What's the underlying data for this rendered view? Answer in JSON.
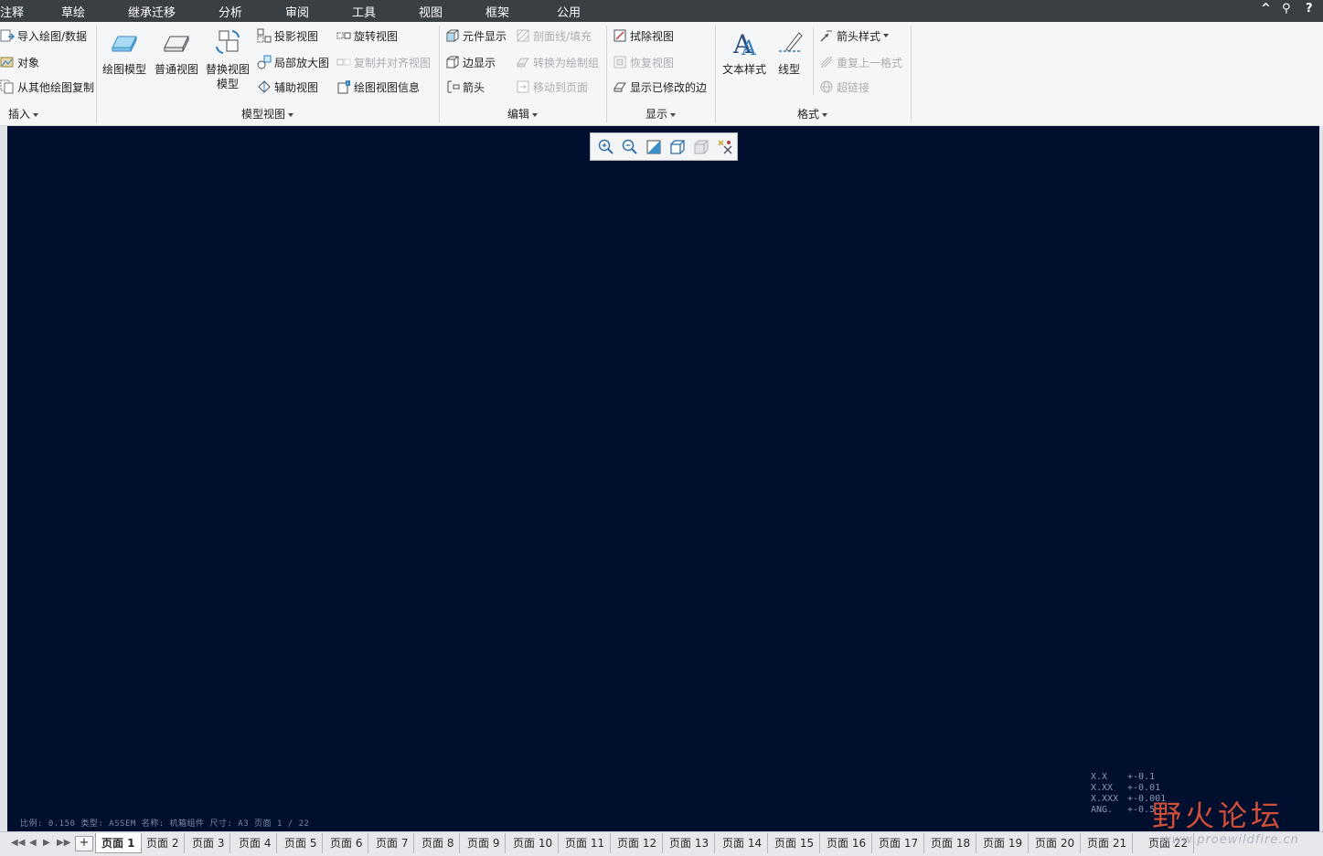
{
  "menubar": {
    "tabs": [
      "注释",
      "草绘",
      "继承迁移",
      "分析",
      "审阅",
      "工具",
      "视图",
      "框架",
      "公用"
    ],
    "right": {
      "collapse": "^",
      "search": "⚲",
      "help": "?"
    }
  },
  "ribbon": {
    "insert": {
      "label": "插入",
      "items": [
        "导入绘图/数据",
        "对象",
        "从其他绘图复制"
      ]
    },
    "model_views": {
      "label": "模型视图",
      "large": [
        "绘图模型",
        "普通视图",
        "替换视图",
        "模型"
      ],
      "col1": [
        "投影视图",
        "局部放大图",
        "辅助视图"
      ],
      "col2": [
        "旋转视图",
        "复制并对齐视图",
        "绘图视图信息"
      ]
    },
    "edit": {
      "label": "编辑",
      "col1": [
        "元件显示",
        "边显示",
        "箭头"
      ],
      "col2": [
        "剖面线/填充",
        "转换为绘制组",
        "移动到页面"
      ]
    },
    "display": {
      "label": "显示",
      "items": [
        "拭除视图",
        "恢复视图",
        "显示已修改的边"
      ]
    },
    "format": {
      "label": "格式",
      "large": [
        "文本样式",
        "线型"
      ],
      "items": [
        "箭头样式",
        "重复上一格式",
        "超链接"
      ]
    }
  },
  "canvas": {
    "background": "#000f2e",
    "sheet_info": "比例: 0.150   类型: ASSEM   名称: 机箱组件   尺寸: A3   页面 1 / 22",
    "tolerance": [
      {
        "key": "X.X",
        "val": "+-0.1"
      },
      {
        "key": "X.XX",
        "val": "+-0.01"
      },
      {
        "key": "X.XXX",
        "val": "+-0.001"
      },
      {
        "key": "ANG.",
        "val": "+-0.5"
      }
    ]
  },
  "watermark": {
    "text": "野火论坛",
    "url": "www.proewildfire.cn"
  },
  "pages": {
    "add": "+",
    "tabs": [
      "页面 1",
      "页面 2",
      "页面 3",
      "页面 4",
      "页面 5",
      "页面 6",
      "页面 7",
      "页面 8",
      "页面 9",
      "页面 10",
      "页面 11",
      "页面 12",
      "页面 13",
      "页面 14",
      "页面 15",
      "页面 16",
      "页面 17",
      "页面 18",
      "页面 19",
      "页面 20",
      "页面 21",
      "页面 22"
    ]
  }
}
